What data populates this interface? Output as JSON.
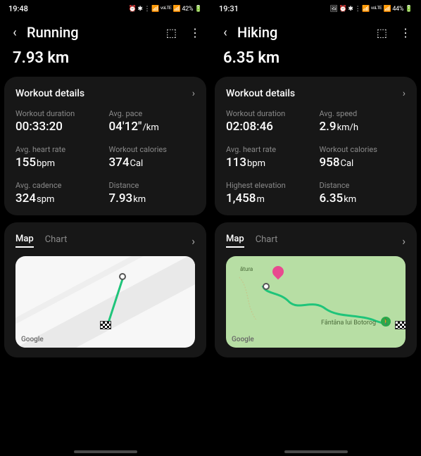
{
  "screens": [
    {
      "status": {
        "time": "19:48",
        "indicators": "⏰ ✱ ⋮ 📶 ᵛᵒᴸᵀᴱ 📶 42% 🔋"
      },
      "header": {
        "title": "Running"
      },
      "distance": "7.93 km",
      "details": {
        "title": "Workout details",
        "stats": [
          {
            "label": "Workout duration",
            "value": "00:33:20",
            "unit": ""
          },
          {
            "label": "Avg. pace",
            "value": "04'12\"",
            "unit": "/km"
          },
          {
            "label": "Avg. heart rate",
            "value": "155",
            "unit": "bpm"
          },
          {
            "label": "Workout calories",
            "value": "374",
            "unit": "Cal"
          },
          {
            "label": "Avg. cadence",
            "value": "324",
            "unit": "spm"
          },
          {
            "label": "Distance",
            "value": "7.93",
            "unit": "km"
          }
        ]
      },
      "tabs": {
        "active": "Map",
        "other": "Chart"
      },
      "map": {
        "attribution": "Google"
      }
    },
    {
      "status": {
        "time": "19:31",
        "indicators": "🖼 ⏰ ✱ ⋮ 📶 ᵛᵒᴸᵀᴱ 📶 44% 🔋"
      },
      "header": {
        "title": "Hiking"
      },
      "distance": "6.35 km",
      "details": {
        "title": "Workout details",
        "stats": [
          {
            "label": "Workout duration",
            "value": "02:08:46",
            "unit": ""
          },
          {
            "label": "Avg. speed",
            "value": "2.9",
            "unit": "km/h"
          },
          {
            "label": "Avg. heart rate",
            "value": "113",
            "unit": "bpm"
          },
          {
            "label": "Workout calories",
            "value": "958",
            "unit": "Cal"
          },
          {
            "label": "Highest elevation",
            "value": "1,458",
            "unit": "m"
          },
          {
            "label": "Distance",
            "value": "6.35",
            "unit": "km"
          }
        ]
      },
      "tabs": {
        "active": "Map",
        "other": "Chart"
      },
      "map": {
        "attribution": "Google",
        "label_main": "Fântâna lui Botorog",
        "label_top": "ătura"
      }
    }
  ]
}
